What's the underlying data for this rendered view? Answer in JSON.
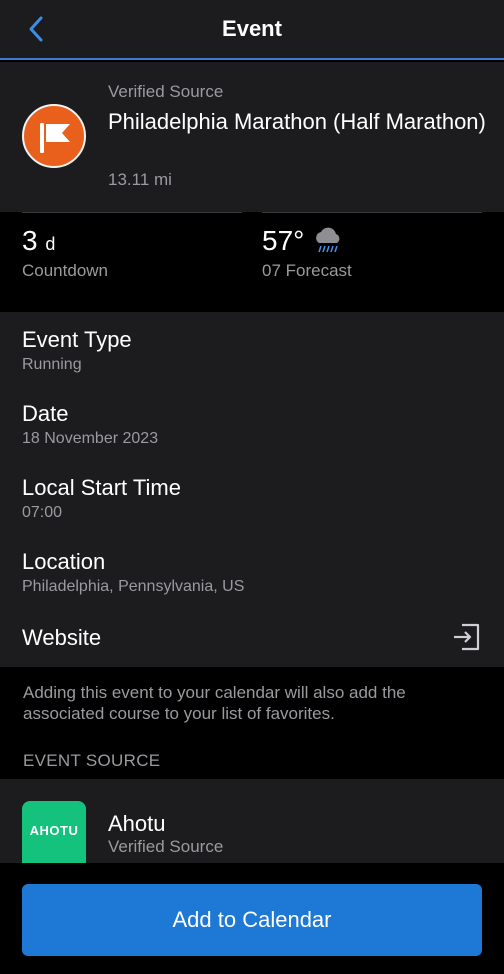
{
  "header": {
    "title": "Event",
    "back_icon": "chevron-left-icon"
  },
  "event": {
    "verified_label": "Verified Source",
    "name": "Philadelphia Marathon (Half Marathon)",
    "distance": "13.11 mi",
    "badge_icon": "flag-icon",
    "badge_color": "#e8601c"
  },
  "stats": {
    "countdown_value": "3",
    "countdown_unit": "d",
    "countdown_label": "Countdown",
    "temp": "57°",
    "forecast_label": "07 Forecast",
    "weather_icon": "rain-cloud-icon"
  },
  "details": {
    "event_type_label": "Event Type",
    "event_type_value": "Running",
    "date_label": "Date",
    "date_value": "18 November 2023",
    "start_time_label": "Local Start Time",
    "start_time_value": "07:00",
    "location_label": "Location",
    "location_value": "Philadelphia, Pennsylvania, US",
    "website_label": "Website",
    "website_icon": "external-link-icon"
  },
  "note": "Adding this event to your calendar will also add the associated course to your list of favorites.",
  "event_source": {
    "heading": "EVENT SOURCE",
    "logo_text": "AHOTU",
    "logo_color": "#15c27d",
    "name": "Ahotu",
    "subtitle": "Verified Source"
  },
  "cta": {
    "label": "Add to Calendar",
    "color": "#1e78d5"
  }
}
